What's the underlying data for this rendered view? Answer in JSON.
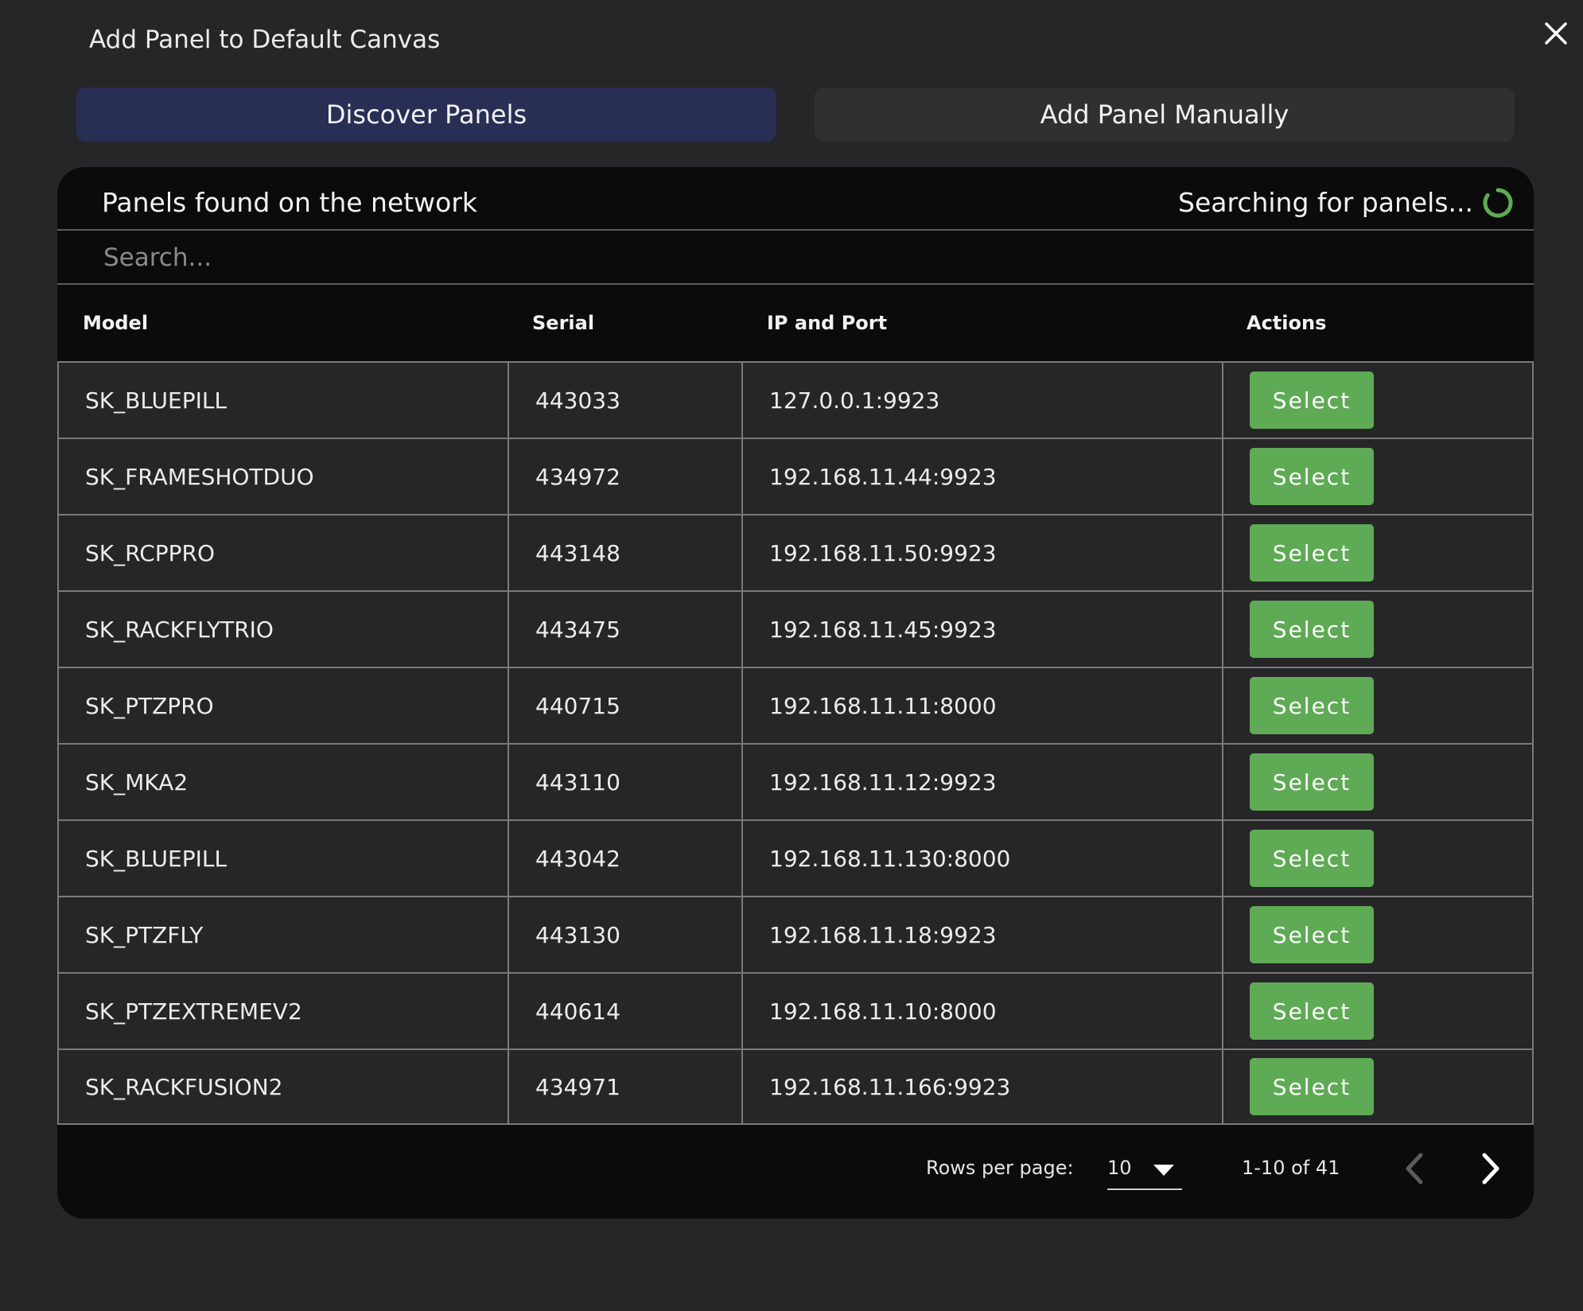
{
  "dialog": {
    "title": "Add Panel to Default Canvas",
    "close_icon": "close-icon"
  },
  "tabs": [
    {
      "label": "Discover Panels",
      "active": true
    },
    {
      "label": "Add Panel Manually",
      "active": false
    }
  ],
  "panel_list": {
    "title": "Panels found on the network",
    "status": "Searching for panels...",
    "status_icon": "spinner-icon",
    "search_placeholder": "Search...",
    "columns": [
      "Model",
      "Serial",
      "IP and Port",
      "Actions"
    ],
    "rows": [
      {
        "model": "SK_BLUEPILL",
        "serial": "443033",
        "ip_port": "127.0.0.1:9923",
        "action": "Select"
      },
      {
        "model": "SK_FRAMESHOTDUO",
        "serial": "434972",
        "ip_port": "192.168.11.44:9923",
        "action": "Select"
      },
      {
        "model": "SK_RCPPRO",
        "serial": "443148",
        "ip_port": "192.168.11.50:9923",
        "action": "Select"
      },
      {
        "model": "SK_RACKFLYTRIO",
        "serial": "443475",
        "ip_port": "192.168.11.45:9923",
        "action": "Select"
      },
      {
        "model": "SK_PTZPRO",
        "serial": "440715",
        "ip_port": "192.168.11.11:8000",
        "action": "Select"
      },
      {
        "model": "SK_MKA2",
        "serial": "443110",
        "ip_port": "192.168.11.12:9923",
        "action": "Select"
      },
      {
        "model": "SK_BLUEPILL",
        "serial": "443042",
        "ip_port": "192.168.11.130:8000",
        "action": "Select"
      },
      {
        "model": "SK_PTZFLY",
        "serial": "443130",
        "ip_port": "192.168.11.18:9923",
        "action": "Select"
      },
      {
        "model": "SK_PTZEXTREMEV2",
        "serial": "440614",
        "ip_port": "192.168.11.10:8000",
        "action": "Select"
      },
      {
        "model": "SK_RACKFUSION2",
        "serial": "434971",
        "ip_port": "192.168.11.166:9923",
        "action": "Select"
      }
    ]
  },
  "pagination": {
    "rows_per_page_label": "Rows per page:",
    "rows_per_page_value": "10",
    "range": "1-10 of 41",
    "prev_icon": "chevron-left-icon",
    "next_icon": "chevron-right-icon"
  },
  "colors": {
    "background": "#262629",
    "active_tab": "#282e54",
    "inactive_tab": "#303033",
    "select_button": "#5faa55",
    "spinner": "#5faa55"
  }
}
